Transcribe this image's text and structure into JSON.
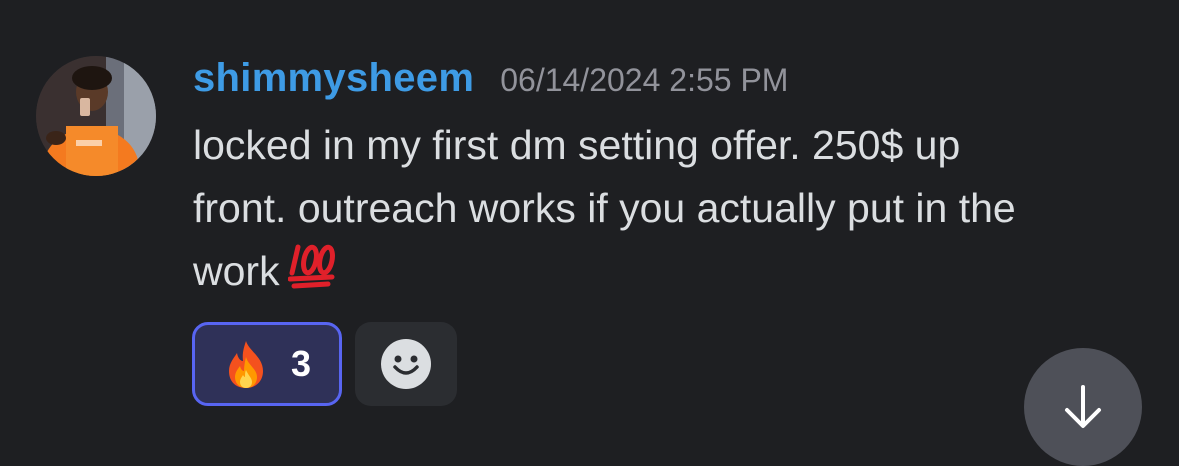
{
  "message": {
    "author": "shimmysheem",
    "timestamp": "06/14/2024 2:55 PM",
    "content_lines": [
      "locked in my first dm setting offer. 250$ up",
      "front. outreach works if you actually put in the",
      "work"
    ],
    "trailing_emoji": "hundred-points-emoji"
  },
  "reactions": [
    {
      "emoji": "fire-emoji",
      "count": "3",
      "reacted_by_me": true
    }
  ],
  "add_reaction": {
    "icon": "smiley-icon"
  },
  "jump_to_bottom": {
    "icon": "arrow-down-icon"
  },
  "colors": {
    "background": "#1e1f22",
    "username": "#3e9be5",
    "timestamp": "#92939b",
    "message_text": "#dbdee1",
    "reaction_active_bg": "#2f3158",
    "reaction_active_border": "#5865f2",
    "button_bg": "#4e5058"
  }
}
